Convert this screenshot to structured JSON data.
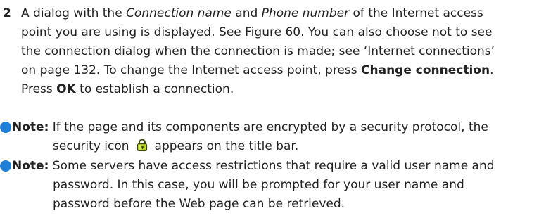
{
  "step": {
    "number": "2",
    "lines": {
      "l1a": "A dialog with the ",
      "l1_em1": "Connection name",
      "l1b": " and ",
      "l1_em2": "Phone number",
      "l1c": " of the Internet access",
      "l2": "point you are using is displayed. See Figure 60. You can also choose not to see",
      "l3": "the connection dialog when the connection is made; see ‘Internet connections’",
      "l4a": "on page 132. To change the Internet access point, press ",
      "l4_strong": "Change connection",
      "l4b": ".",
      "l5a": "Press ",
      "l5_strong": "OK",
      "l5b": " to establish a connection."
    }
  },
  "notes": [
    {
      "label": "Note:",
      "line1": " If the page and its components are encrypted by a security protocol, the",
      "line2a": "security icon",
      "line2b": "appears on the title bar.",
      "icon": "lock-icon"
    },
    {
      "label": "Note:",
      "line1": " Some servers have access restrictions that require a valid user name and",
      "line2": "password. In this case, you will be prompted for your user name and",
      "line3": "password before the Web page can be retrieved."
    }
  ],
  "colors": {
    "bullet": "#1f7fd6",
    "lock_body": "#b8d12a",
    "lock_outline": "#3a4a12"
  }
}
